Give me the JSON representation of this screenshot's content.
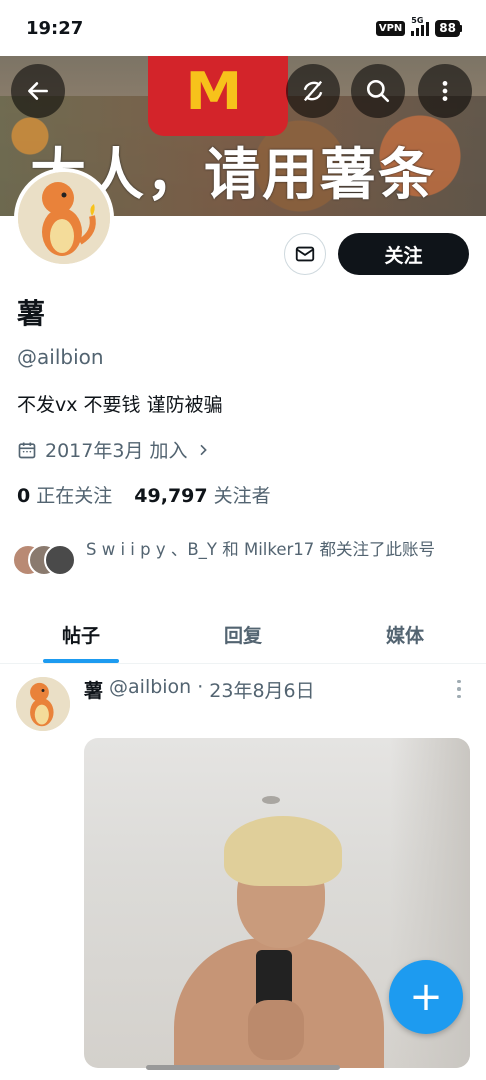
{
  "status_bar": {
    "time": "19:27",
    "vpn": "VPN",
    "network": "5G",
    "battery": "88"
  },
  "banner": {
    "text": "大人，请用薯条",
    "logo_letter": "M"
  },
  "header_buttons": {
    "back": "back-arrow-icon",
    "translate": "translate-icon",
    "search": "search-icon",
    "more": "more-vertical-icon"
  },
  "profile": {
    "name": "薯",
    "handle": "@ailbion",
    "bio": "不发vx 不要钱 谨防被骗",
    "joined": "2017年3月 加入",
    "following_count": "0",
    "following_label": "正在关注",
    "followers_count": "49,797",
    "followers_label": "关注者",
    "followed_by": "S w i i p y 、B_Y 和 Milker17 都关注了此账号"
  },
  "actions": {
    "follow_label": "关注"
  },
  "tabs": [
    {
      "label": "帖子"
    },
    {
      "label": "回复"
    },
    {
      "label": "媒体"
    }
  ],
  "tweet": {
    "name": "薯",
    "handle": "@ailbion",
    "separator": "·",
    "date": "23年8月6日"
  },
  "fab": {
    "label": "+"
  },
  "colors": {
    "accent": "#1d9bf0",
    "text": "#0f1419",
    "secondary": "#536471"
  }
}
